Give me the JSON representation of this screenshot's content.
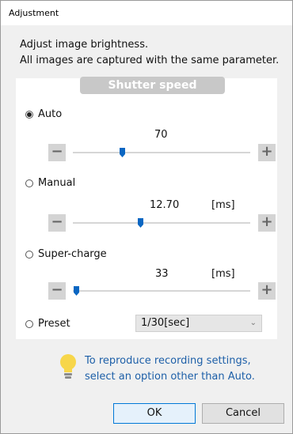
{
  "window": {
    "title": "Adjustment"
  },
  "description": {
    "line1": "Adjust image brightness.",
    "line2": "All images are captured with the same parameter."
  },
  "section": {
    "title": "Shutter speed"
  },
  "modes": [
    {
      "label": "Auto",
      "selected": true,
      "value": "70",
      "unit": "",
      "slider_fraction": 0.28
    },
    {
      "label": "Manual",
      "selected": false,
      "value": "12.70",
      "unit": "[ms]",
      "slider_fraction": 0.38
    },
    {
      "label": "Super-charge",
      "selected": false,
      "value": "33",
      "unit": "[ms]",
      "slider_fraction": 0.02
    }
  ],
  "stepper": {
    "minus": "−",
    "plus": "+"
  },
  "preset": {
    "label": "Preset",
    "selected": false,
    "value": "1/30[sec]",
    "chevron": "⌄"
  },
  "hint": {
    "line1": "To reproduce recording settings,",
    "line2": "select an option other than Auto."
  },
  "buttons": {
    "ok": "OK",
    "cancel": "Cancel"
  },
  "colors": {
    "accent": "#0078d7",
    "hint_text": "#1d5fa8",
    "header_bg": "#c8c8c8"
  }
}
